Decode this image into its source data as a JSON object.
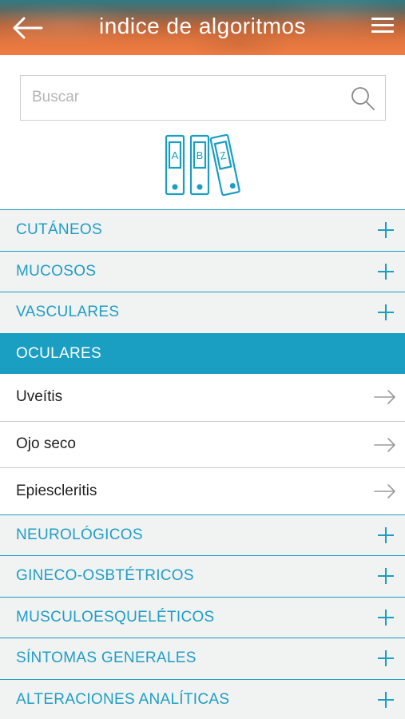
{
  "header": {
    "title": "indice de algoritmos"
  },
  "search": {
    "placeholder": "Buscar"
  },
  "books": {
    "labels": [
      "A",
      "B",
      "Z"
    ]
  },
  "categories": [
    {
      "label": "CUTÁNEOS"
    },
    {
      "label": "MUCOSOS"
    },
    {
      "label": "VASCULARES"
    },
    {
      "label": "OCULARES"
    },
    {
      "label": "NEUROLÓGICOS"
    },
    {
      "label": "GINECO-OSBTÉTRICOS"
    },
    {
      "label": "MUSCULOESQUELÉTICOS"
    },
    {
      "label": "SÍNTOMAS GENERALES"
    },
    {
      "label": "ALTERACIONES ANALÍTICAS"
    }
  ],
  "ocular_items": [
    {
      "label": "Uveítis"
    },
    {
      "label": "Ojo seco"
    },
    {
      "label": "Epiescleritis"
    }
  ],
  "colors": {
    "accent": "#1a9ec2",
    "header_orange": "#f07c42",
    "row_bg": "#f1f2f2"
  },
  "icons": {
    "back": "arrow-left-icon",
    "menu": "hamburger-icon",
    "search": "magnifier-icon",
    "expand": "plus-icon",
    "open": "arrow-right-icon"
  }
}
